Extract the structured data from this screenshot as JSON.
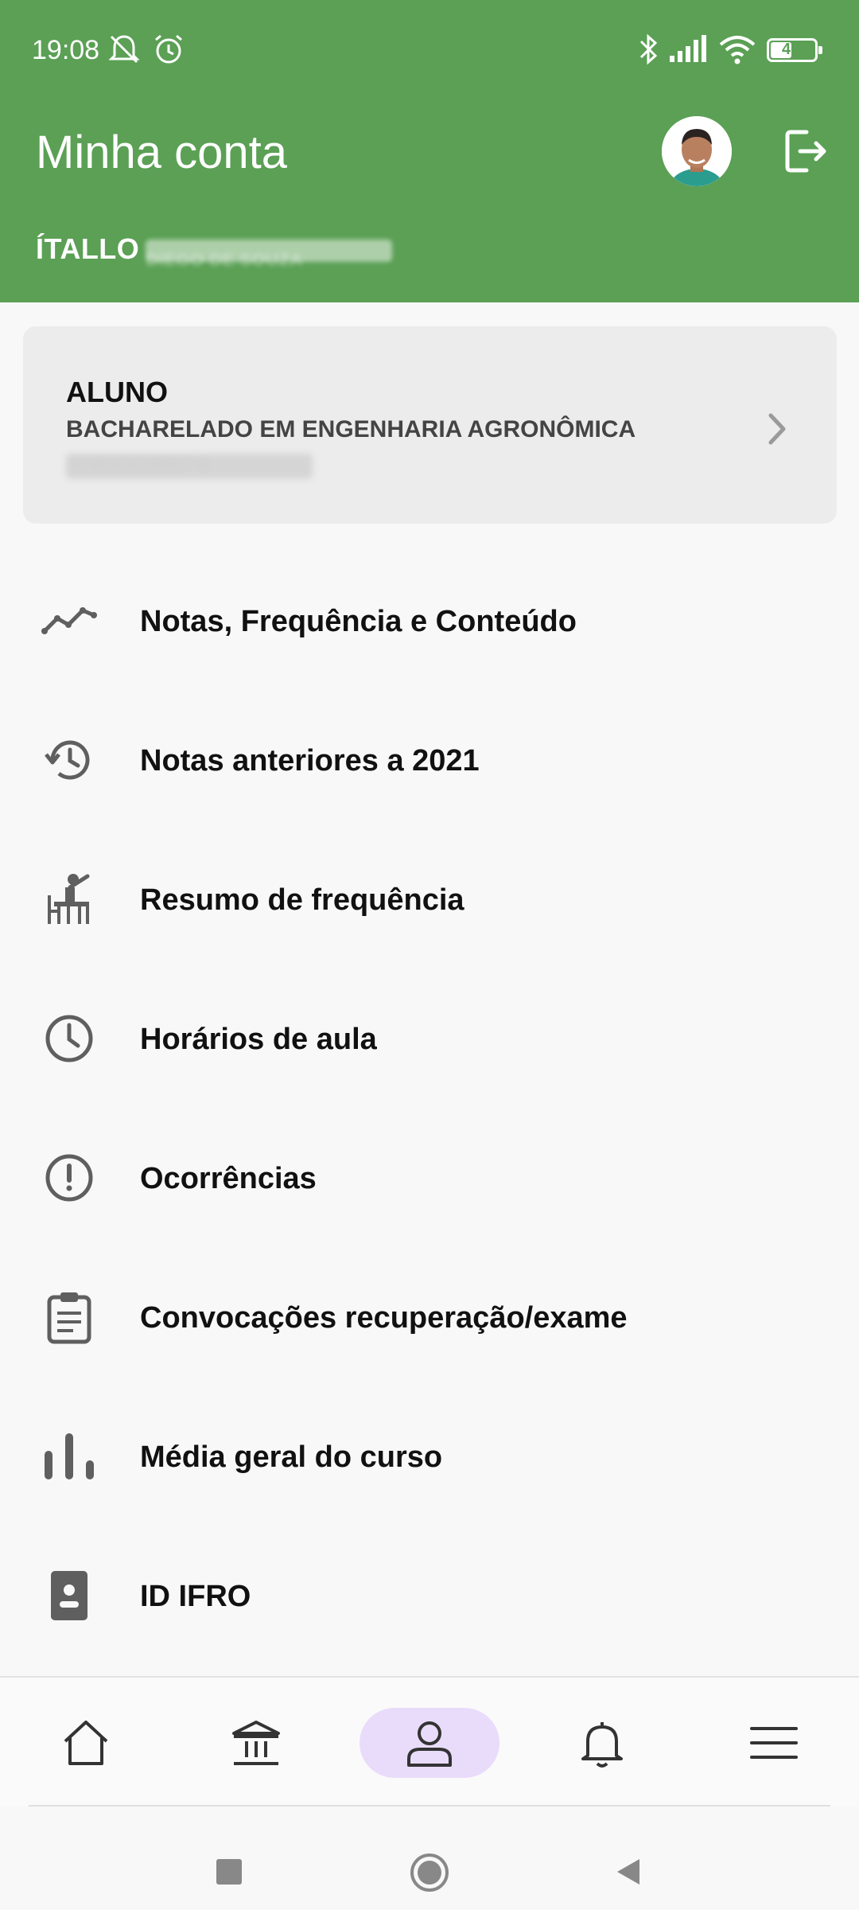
{
  "status_bar": {
    "time": "19:08",
    "battery": "46",
    "icons": [
      "notifications-off-icon",
      "alarm-icon",
      "bluetooth-icon",
      "signal-icon",
      "wifi-icon",
      "battery-icon"
    ]
  },
  "header": {
    "title": "Minha conta",
    "user_name_visible": "ÍTALLO",
    "user_name_hidden": "DIEGO DE SOUZA"
  },
  "student_card": {
    "role": "ALUNO",
    "course": "BACHARELADO EM ENGENHARIA AGRONÔMICA",
    "registration": "2018101019007-6"
  },
  "menu": {
    "items": [
      {
        "label": "Notas, Frequência e Conteúdo",
        "icon": "trending-line-icon"
      },
      {
        "label": "Notas anteriores a 2021",
        "icon": "history-icon"
      },
      {
        "label": "Resumo de frequência",
        "icon": "student-desk-icon"
      },
      {
        "label": "Horários de aula",
        "icon": "clock-icon"
      },
      {
        "label": "Ocorrências",
        "icon": "alert-circle-icon"
      },
      {
        "label": "Convocações recuperação/exame",
        "icon": "clipboard-icon"
      },
      {
        "label": "Média geral do curso",
        "icon": "bar-chart-icon"
      },
      {
        "label": "ID IFRO",
        "icon": "id-badge-icon"
      }
    ]
  },
  "bottom_nav": {
    "items": [
      "home-icon",
      "institution-icon",
      "person-icon",
      "bell-icon",
      "menu-icon"
    ],
    "active": "person-icon"
  },
  "colors": {
    "header_bg": "#5ba055",
    "active_nav_bg": "#e9dcfb",
    "icon_gray": "#5f5f5f"
  }
}
